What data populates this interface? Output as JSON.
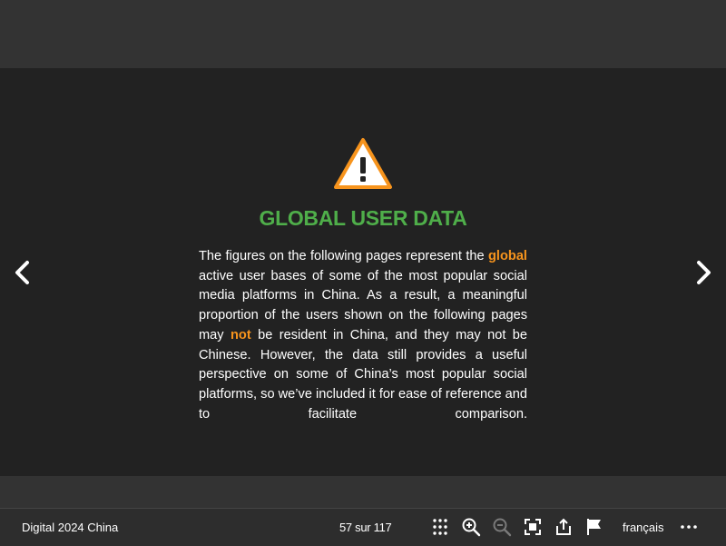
{
  "slide": {
    "title": "GLOBAL USER DATA",
    "paragraph": {
      "p1": "The figures on the following pages represent the ",
      "hl1": "global",
      "p2": " active user bases of some of the most popular social media platforms in China. As a result, a meaningful proportion of the users shown on the following pages may ",
      "hl2": "not",
      "p3": " be resident in China, and they may not be Chinese. However, the data still provides a useful perspective on some of China’s most popular social platforms, so we’ve included it for ease of reference and to facilitate comparison."
    }
  },
  "toolbar": {
    "doc_title": "Digital 2024 China",
    "page_indicator": "57 sur 117",
    "language": "français"
  },
  "colors": {
    "accent_green": "#4fae4a",
    "highlight_orange": "#f7941d",
    "warning_orange": "#f7941d"
  },
  "icons": [
    "warning-icon",
    "chevron-left-icon",
    "chevron-right-icon",
    "grid-icon",
    "zoom-in-icon",
    "zoom-out-icon",
    "fullscreen-icon",
    "share-icon",
    "flag-icon",
    "more-icon"
  ]
}
